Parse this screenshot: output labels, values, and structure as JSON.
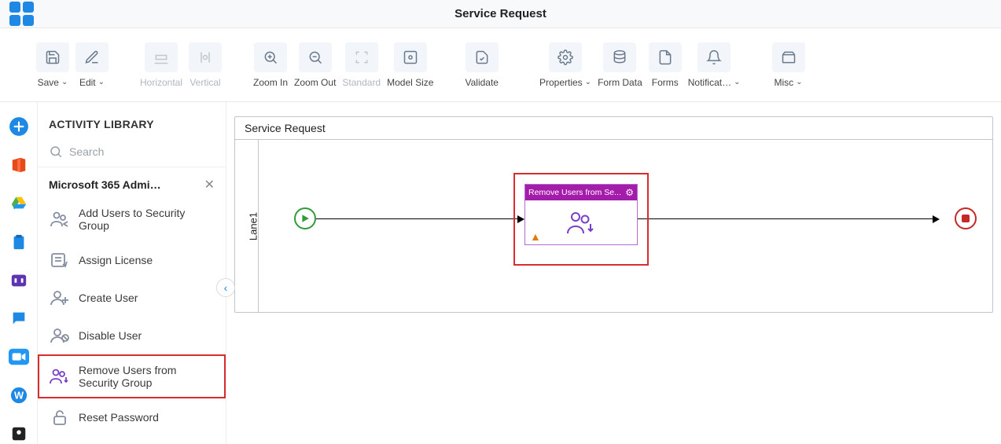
{
  "topbar": {
    "title": "Service Request"
  },
  "toolbar": {
    "save": {
      "label": "Save"
    },
    "edit": {
      "label": "Edit"
    },
    "horiz": {
      "label": "Horizontal"
    },
    "vert": {
      "label": "Vertical"
    },
    "zoomin": {
      "label": "Zoom In"
    },
    "zoomout": {
      "label": "Zoom Out"
    },
    "standard": {
      "label": "Standard"
    },
    "model": {
      "label": "Model Size"
    },
    "validate": {
      "label": "Validate"
    },
    "props": {
      "label": "Properties"
    },
    "formdata": {
      "label": "Form Data"
    },
    "forms": {
      "label": "Forms"
    },
    "notif": {
      "label": "Notificat…"
    },
    "misc": {
      "label": "Misc"
    }
  },
  "sidebar": {
    "header": "ACTIVITY LIBRARY",
    "search_placeholder": "Search",
    "category": "Microsoft 365 Admi…",
    "activities": [
      {
        "label": "Add Users to Security Group"
      },
      {
        "label": "Assign License"
      },
      {
        "label": "Create User"
      },
      {
        "label": "Disable User"
      },
      {
        "label": "Remove Users from Security Group"
      },
      {
        "label": "Reset Password"
      }
    ]
  },
  "process": {
    "title": "Service Request",
    "lane": "Lane1",
    "activity_header": "Remove Users from Se..."
  }
}
